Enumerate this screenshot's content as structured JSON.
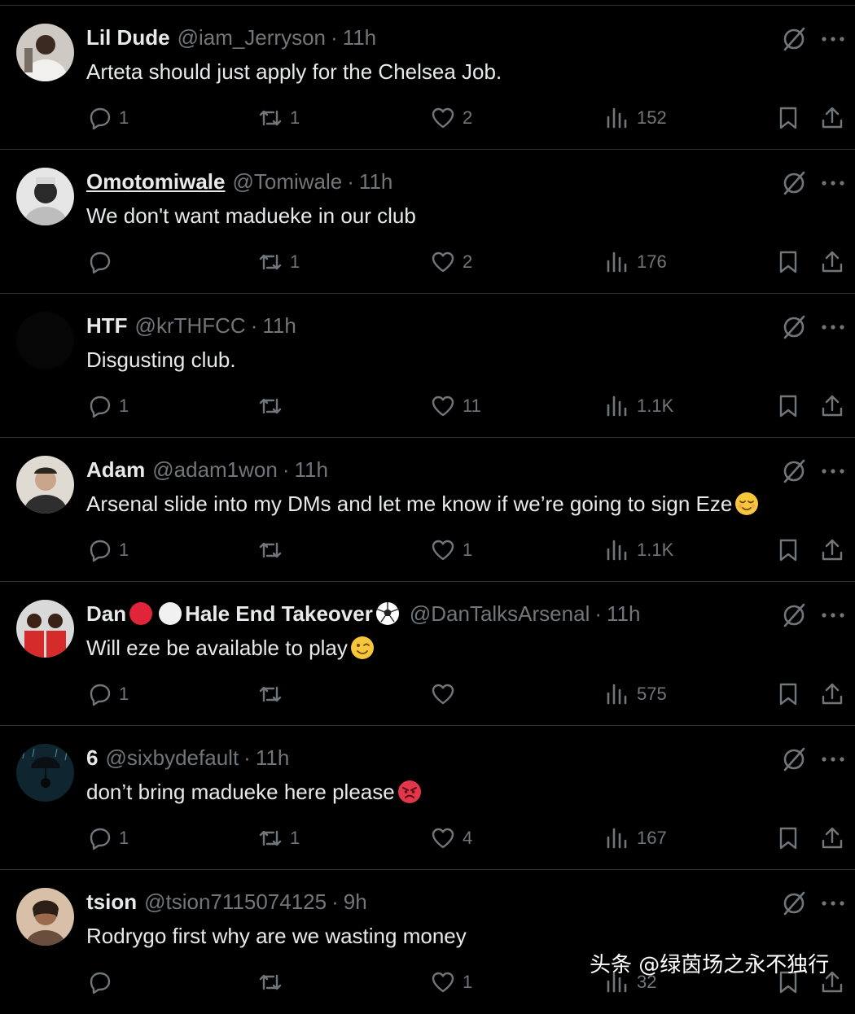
{
  "tweets": [
    {
      "name": "Lil Dude",
      "handle": "@iam_Jerryson",
      "sep": "·",
      "time": "11h",
      "text": "Arteta should just apply for the Chelsea Job.",
      "reply": "1",
      "retweet": "1",
      "like": "2",
      "views": "152",
      "avatar": "woman-photo",
      "avatar_color": "#c8c2bd"
    },
    {
      "name": "Omotomiwale",
      "handle": "@Tomiwale",
      "sep": "·",
      "time": "11h",
      "text": "We don't want madueke in our club",
      "reply": "",
      "retweet": "1",
      "like": "2",
      "views": "176",
      "avatar": "man-grayscale-photo",
      "avatar_color": "#9a9a9a"
    },
    {
      "name": "HTF",
      "handle": "@krTHFCC",
      "sep": "·",
      "time": "11h",
      "text": "Disgusting club.",
      "reply": "1",
      "retweet": "",
      "like": "11",
      "views": "1.1K",
      "avatar": "dark-blank",
      "avatar_color": "#060606"
    },
    {
      "name": "Adam",
      "handle": "@adam1won",
      "sep": "·",
      "time": "11h",
      "text": "Arsenal slide into my DMs and let me know if we’re going to sign Eze",
      "text_emoji": "relieved-face",
      "reply": "1",
      "retweet": "",
      "like": "1",
      "views": "1.1K",
      "avatar": "man-photo",
      "avatar_color": "#d9d4cc"
    },
    {
      "name": "Dan",
      "name_suffix": "Hale End Takeover",
      "name_emojis": [
        "red-circle",
        "white-circle"
      ],
      "name_trailing_emoji": "soccer-ball",
      "handle": "@DanTalksArsenal",
      "sep": "·",
      "time": "11h",
      "text": "Will eze be available to play",
      "text_emoji": "winking-face",
      "reply": "1",
      "retweet": "",
      "like": "",
      "views": "575",
      "avatar": "two-players-photo",
      "avatar_color": "#c41e24"
    },
    {
      "name": "6",
      "handle": "@sixbydefault",
      "sep": "·",
      "time": "11h",
      "text": "don’t bring madueke here please",
      "text_emoji": "angry-face",
      "reply": "1",
      "retweet": "1",
      "like": "4",
      "views": "167",
      "avatar": "umbrella-rain-photo",
      "avatar_color": "#1d3a4a"
    },
    {
      "name": "tsion",
      "handle": "@tsion7115074125",
      "sep": "·",
      "time": "9h",
      "text": "Rodrygo first why are we wasting money",
      "reply": "",
      "retweet": "",
      "like": "1",
      "views": "32",
      "avatar": "woman-portrait-photo",
      "avatar_color": "#b88a6d"
    }
  ],
  "watermark": "头条 @绿茵场之永不独行",
  "colors": {
    "background": "#000000",
    "text": "#e7e9ea",
    "muted": "#71767b",
    "divider": "#2f3336"
  }
}
